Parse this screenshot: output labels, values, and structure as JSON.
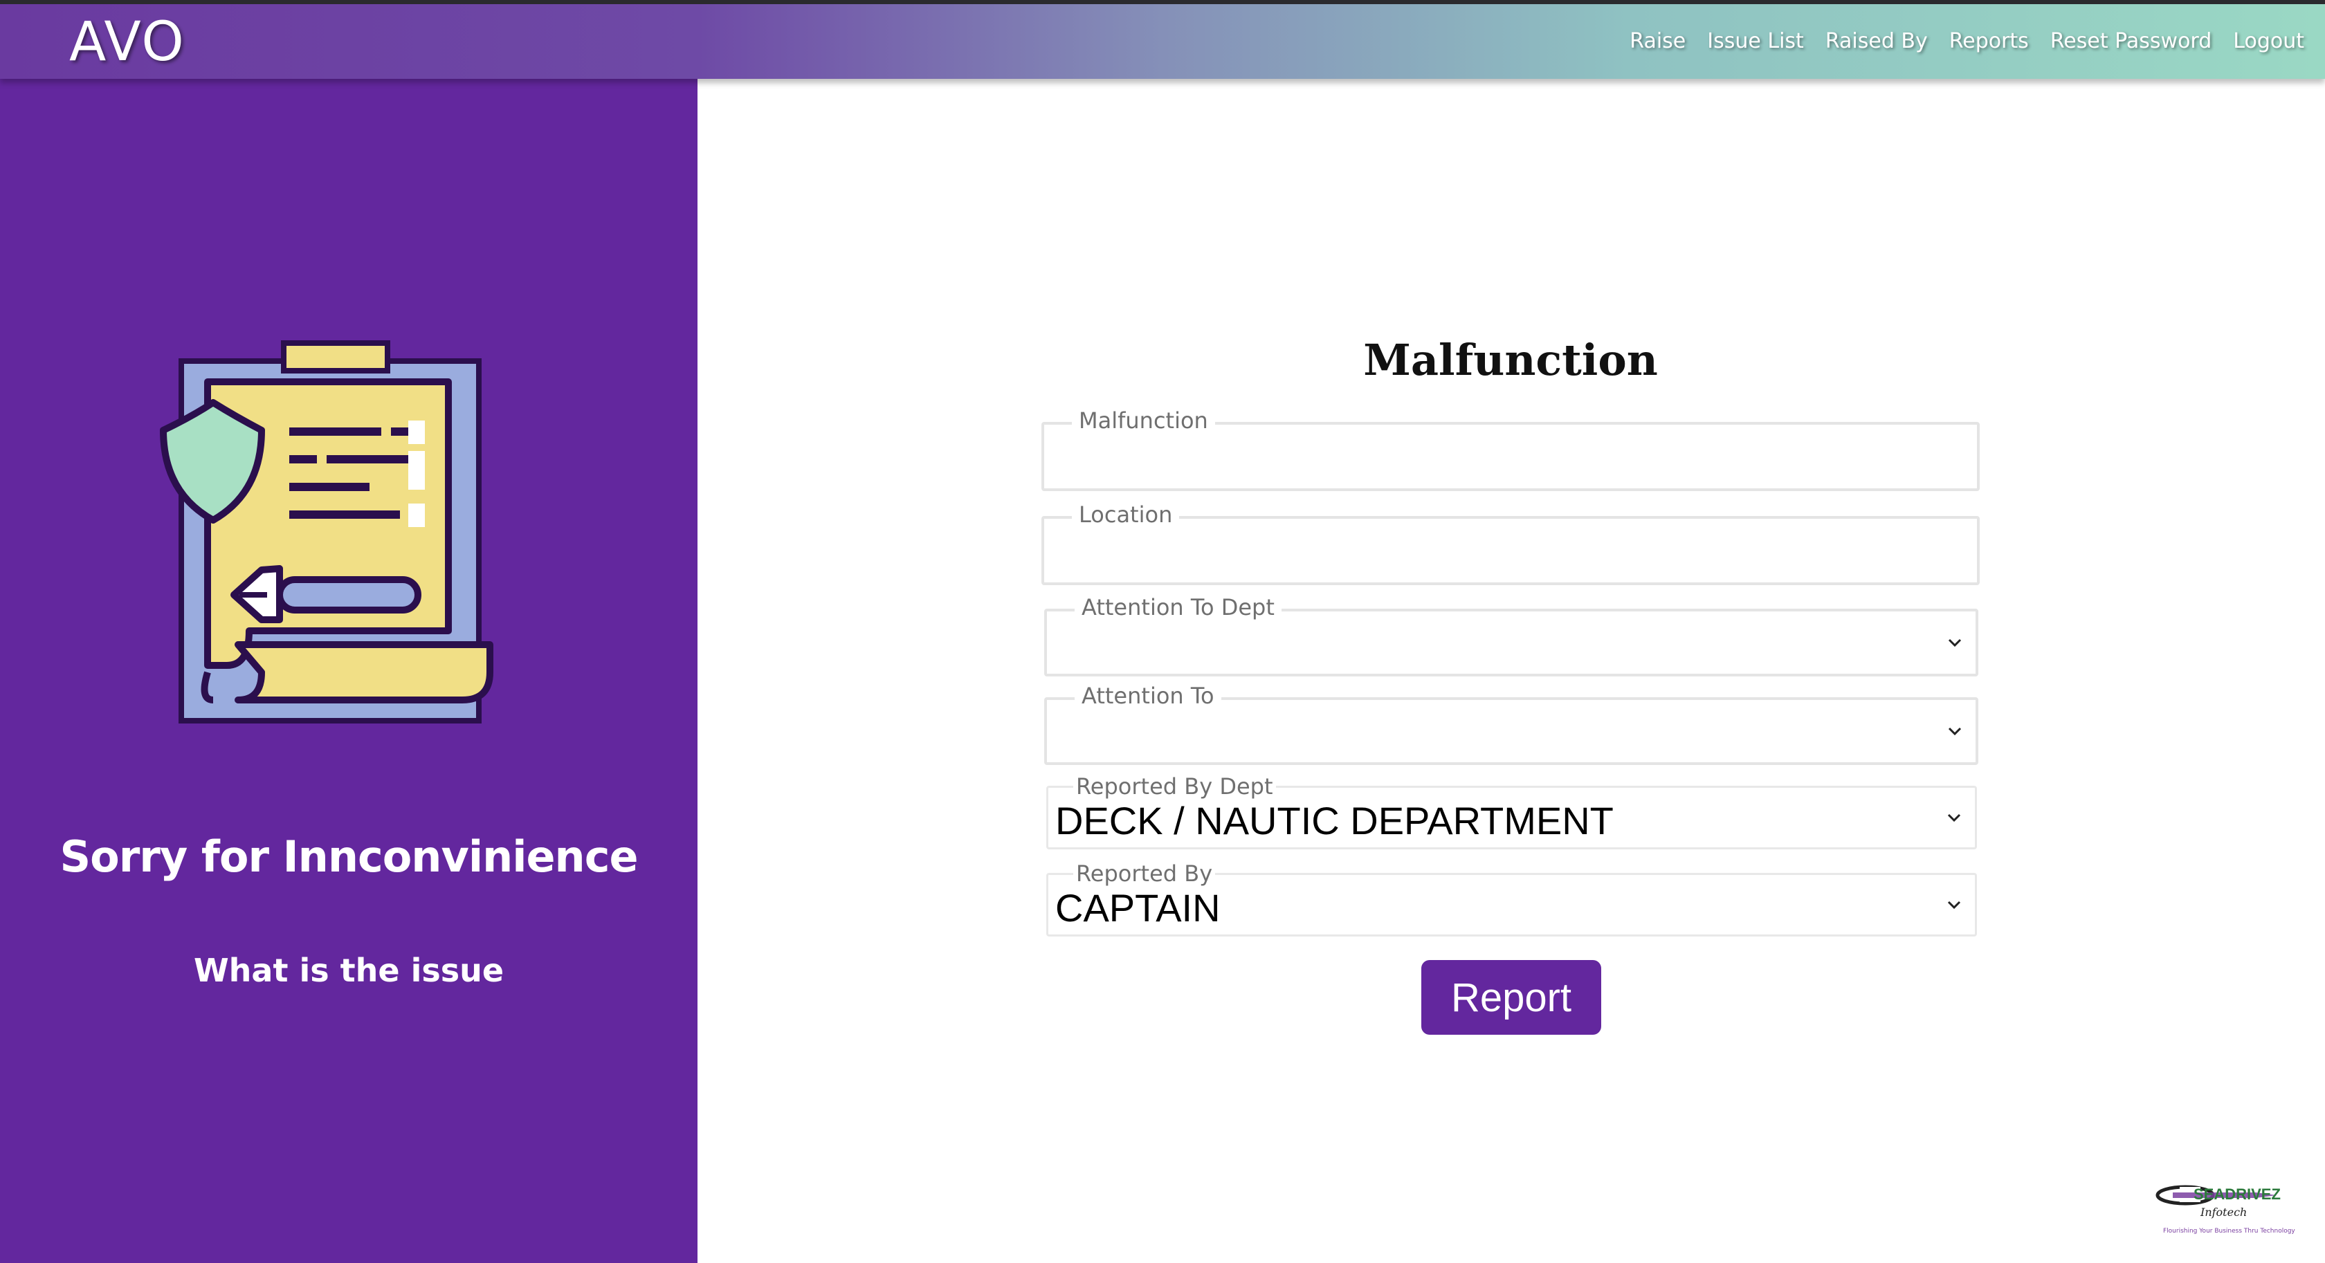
{
  "header": {
    "brand": "AVO",
    "nav": [
      {
        "label": "Raise"
      },
      {
        "label": "Issue List"
      },
      {
        "label": "Raised By"
      },
      {
        "label": "Reports"
      },
      {
        "label": "Reset Password"
      },
      {
        "label": "Logout"
      }
    ]
  },
  "left_panel": {
    "heading": "Sorry for Innconvinience",
    "subheading": "What is the issue",
    "illustration_icon": "clipboard-document-icon"
  },
  "form": {
    "title": "Malfunction",
    "fields": {
      "malfunction": {
        "label": "Malfunction",
        "value": ""
      },
      "location": {
        "label": "Location",
        "value": ""
      },
      "attention_to_dept": {
        "label": "Attention To Dept",
        "value": ""
      },
      "attention_to": {
        "label": "Attention To",
        "value": ""
      },
      "reported_by_dept": {
        "label": "Reported By Dept",
        "value": "DECK / NAUTIC DEPARTMENT"
      },
      "reported_by": {
        "label": "Reported By",
        "value": "CAPTAIN"
      }
    },
    "submit_label": "Report"
  },
  "footer": {
    "logo_text": "SEADRIVEZ",
    "logo_tagline": "Flourishing Your Business Thru Technology"
  },
  "colors": {
    "primary_purple": "#63279e",
    "nav_gradient_start": "#6a3aa0",
    "nav_gradient_end": "#9ad8c4"
  }
}
